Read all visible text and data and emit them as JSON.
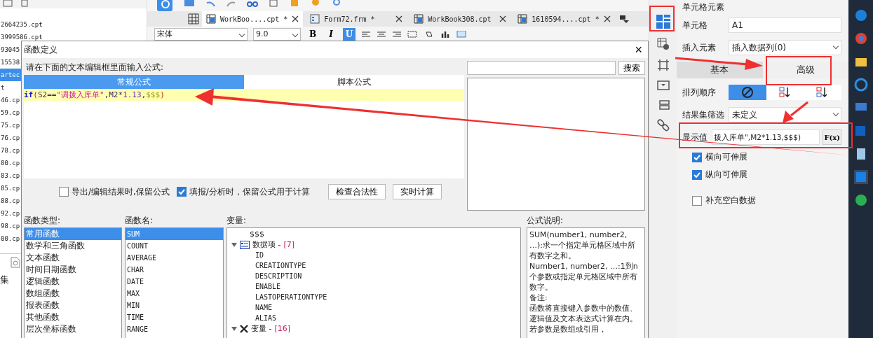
{
  "file_list": [
    {
      "name": "2664235.cpt",
      "selected": false
    },
    {
      "name": "3999586.cpt",
      "selected": false
    },
    {
      "name": "93045",
      "selected": false
    },
    {
      "name": "15538",
      "selected": false
    },
    {
      "name": "artec",
      "selected": true
    },
    {
      "name": "t",
      "selected": false
    },
    {
      "name": "46.cp",
      "selected": false
    },
    {
      "name": "59.cp",
      "selected": false
    },
    {
      "name": "75.cp",
      "selected": false
    },
    {
      "name": "76.cp",
      "selected": false
    },
    {
      "name": "78.cp",
      "selected": false
    },
    {
      "name": "80.cp",
      "selected": false
    },
    {
      "name": "83.cp",
      "selected": false
    },
    {
      "name": "85.cp",
      "selected": false
    },
    {
      "name": "88.cp",
      "selected": false
    },
    {
      "name": "92.cp",
      "selected": false
    },
    {
      "name": "98.cp",
      "selected": false
    },
    {
      "name": "00.cp",
      "selected": false
    }
  ],
  "left_bottom_label": "集",
  "editor_tabs": [
    {
      "label": "WorkBoo....cpt *",
      "selected": true,
      "kind": "cpt"
    },
    {
      "label": "Form72.frm *",
      "selected": false,
      "kind": "frm"
    },
    {
      "label": "WorkBook308.cpt",
      "selected": false,
      "kind": "cpt"
    },
    {
      "label": "1610594....cpt *",
      "selected": false,
      "kind": "cpt"
    }
  ],
  "toolbar": {
    "font": "宋体",
    "size": "9.0",
    "format_buttons": [
      {
        "label": "B",
        "selected": false
      },
      {
        "label": "I",
        "selected": false
      },
      {
        "label": "U",
        "selected": true
      }
    ]
  },
  "dialog": {
    "title": "函数定义",
    "close": "×",
    "prompt": "请在下面的文本编辑框里面输入公式:",
    "formula_tabs": [
      {
        "label": "常规公式",
        "selected": true
      },
      {
        "label": "脚本公式",
        "selected": false
      }
    ],
    "formula_tokens": [
      {
        "text": "if",
        "kind": "keyword"
      },
      {
        "text": "(",
        "kind": "paren"
      },
      {
        "text": "S2",
        "kind": "ref"
      },
      {
        "text": "==",
        "kind": "op"
      },
      {
        "text": "\"调拨入库单\"",
        "kind": "string"
      },
      {
        "text": ",",
        "kind": "op"
      },
      {
        "text": "M2",
        "kind": "ref"
      },
      {
        "text": "*",
        "kind": "op"
      },
      {
        "text": "1.13",
        "kind": "number"
      },
      {
        "text": ",",
        "kind": "op"
      },
      {
        "text": "$$$",
        "kind": "var"
      },
      {
        "text": ")",
        "kind": "paren"
      }
    ],
    "options": [
      {
        "label": "导出/编辑结果时,保留公式",
        "checked": false
      },
      {
        "label": "填报/分析时，保留公式用于计算",
        "checked": true
      }
    ],
    "action_buttons": [
      "检查合法性",
      "实时计算"
    ],
    "search_button": "搜索",
    "function_types": {
      "heading": "函数类型:",
      "items": [
        {
          "label": "常用函数",
          "selected": true
        },
        {
          "label": "数学和三角函数",
          "selected": false
        },
        {
          "label": "文本函数",
          "selected": false
        },
        {
          "label": "时间日期函数",
          "selected": false
        },
        {
          "label": "逻辑函数",
          "selected": false
        },
        {
          "label": "数组函数",
          "selected": false
        },
        {
          "label": "报表函数",
          "selected": false
        },
        {
          "label": "其他函数",
          "selected": false
        },
        {
          "label": "层次坐标函数",
          "selected": false
        }
      ]
    },
    "function_names": {
      "heading": "函数名:",
      "items": [
        {
          "label": "SUM",
          "selected": true
        },
        {
          "label": "COUNT",
          "selected": false
        },
        {
          "label": "AVERAGE",
          "selected": false
        },
        {
          "label": "CHAR",
          "selected": false
        },
        {
          "label": "DATE",
          "selected": false
        },
        {
          "label": "MAX",
          "selected": false
        },
        {
          "label": "MIN",
          "selected": false
        },
        {
          "label": "TIME",
          "selected": false
        },
        {
          "label": "RANGE",
          "selected": false
        }
      ]
    },
    "variables": {
      "heading": "变量:",
      "items": [
        {
          "label": "$$$",
          "kind": "leaf"
        },
        {
          "label": "数据项 -",
          "count": "[7]",
          "kind": "dataset",
          "expanded": true,
          "children": [
            {
              "label": "ID",
              "kind": "field"
            },
            {
              "label": "CREATIONTYPE",
              "kind": "field"
            },
            {
              "label": "DESCRIPTION",
              "kind": "field"
            },
            {
              "label": "ENABLE",
              "kind": "field"
            },
            {
              "label": "LASTOPERATIONTYPE",
              "kind": "field"
            },
            {
              "label": "NAME",
              "kind": "field"
            },
            {
              "label": "ALIAS",
              "kind": "field"
            }
          ]
        },
        {
          "label": "变量 -",
          "count": "[16]",
          "kind": "variables",
          "expanded": true
        }
      ]
    },
    "description": {
      "heading": "公式说明:",
      "paragraphs": [
        "SUM(number1, number2, …):求一个指定单元格区域中所有数字之和。",
        "Number1, number2, …:1到n个参数或指定单元格区域中所有数字。",
        "备注:",
        "函数将直接键入参数中的数值、逻辑值及文本表达式计算在内。若参数是数组或引用，"
      ]
    }
  },
  "properties": {
    "title": "单元格元素",
    "cell": {
      "label": "单元格",
      "value": "A1"
    },
    "insert": {
      "label": "插入元素",
      "value": "插入数据列(0)"
    },
    "tabs": [
      {
        "label": "基本",
        "selected": false
      },
      {
        "label": "高级",
        "selected": true
      }
    ],
    "sort": {
      "label": "排列顺序",
      "options": [
        {
          "kind": "none",
          "selected": true
        },
        {
          "kind": "ascending",
          "selected": false
        },
        {
          "kind": "descending",
          "selected": false
        }
      ]
    },
    "filter": {
      "label": "结果集筛选",
      "value": "未定义"
    },
    "display": {
      "label": "显示值",
      "value": "拨入库单\",M2*1.13,$$$)",
      "button": "F(x)"
    },
    "checks": [
      {
        "label": "横向可伸展",
        "checked": true
      },
      {
        "label": "纵向可伸展",
        "checked": true
      },
      {
        "label": "补充空白数据",
        "checked": false
      }
    ]
  }
}
